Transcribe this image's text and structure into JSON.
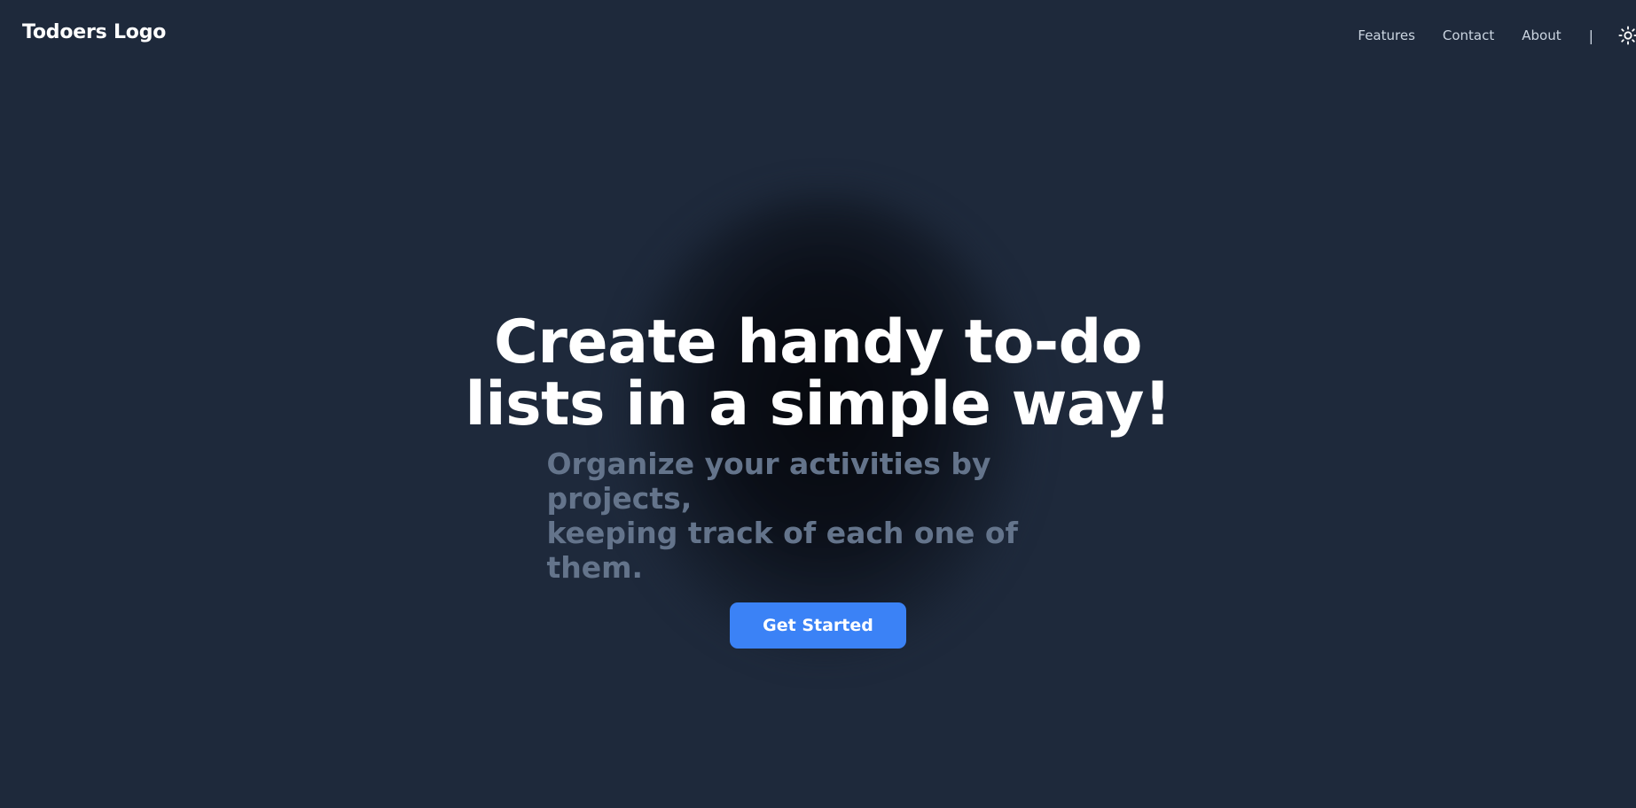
{
  "header": {
    "logo_text": "Todoers Logo",
    "nav": {
      "features": "Features",
      "contact": "Contact",
      "about": "About",
      "separator": "|"
    },
    "theme_toggle_icon": "sun-icon"
  },
  "hero": {
    "headline_line1": "Create handy to-do",
    "headline_line2": "lists in a simple way!",
    "subheadline_line1": "Organize your activities by projects,",
    "subheadline_line2": "keeping track of each one of them.",
    "cta_label": "Get Started"
  },
  "colors": {
    "background": "#1e293b",
    "accent": "#3b82f6",
    "heading": "#ffffff",
    "subheading": "#64748b",
    "nav_text": "#cbd5e1"
  }
}
